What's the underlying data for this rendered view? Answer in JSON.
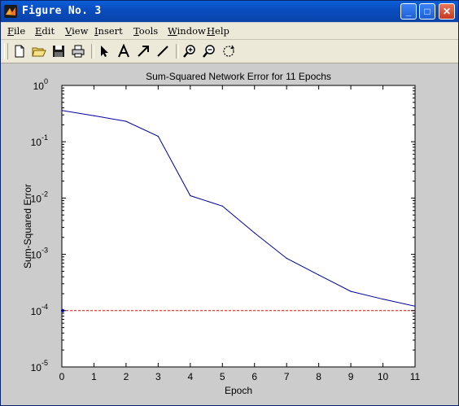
{
  "window": {
    "title": "Figure No. 3",
    "minimize_icon": "minimize-icon",
    "maximize_icon": "maximize-icon",
    "close_icon": "close-icon",
    "app_icon": "matlab-icon"
  },
  "menubar": {
    "items": [
      "File",
      "Edit",
      "View",
      "Insert",
      "Tools",
      "Window",
      "Help"
    ]
  },
  "toolbar": {
    "tools": [
      "new-figure-icon",
      "open-icon",
      "save-icon",
      "print-icon",
      "pointer-icon",
      "text-icon",
      "arrow-icon",
      "line-icon",
      "zoom-in-icon",
      "zoom-out-icon",
      "rotate-icon"
    ]
  },
  "chart_data": {
    "type": "line",
    "title": "Sum-Squared Network Error for 11 Epochs",
    "xlabel": "Epoch",
    "ylabel": "Sum-Squared Error",
    "yscale": "log",
    "xlim": [
      0,
      11
    ],
    "ylim": [
      1e-05,
      1
    ],
    "xticks": [
      "0",
      "1",
      "2",
      "3",
      "4",
      "5",
      "6",
      "7",
      "8",
      "9",
      "10",
      "11"
    ],
    "yticks": [
      {
        "base": "10",
        "exp": "0"
      },
      {
        "base": "10",
        "exp": "-1"
      },
      {
        "base": "10",
        "exp": "-2"
      },
      {
        "base": "10",
        "exp": "-3"
      },
      {
        "base": "10",
        "exp": "-4"
      },
      {
        "base": "10",
        "exp": "-5"
      }
    ],
    "series": [
      {
        "color": "#0000a0",
        "x": [
          0,
          1,
          2,
          3,
          4,
          5,
          6,
          7,
          8,
          9,
          10,
          11
        ],
        "y": [
          0.36,
          0.29,
          0.23,
          0.125,
          0.011,
          0.0072,
          0.0024,
          0.00085,
          0.00043,
          0.00022,
          0.00016,
          0.00012
        ]
      }
    ],
    "goal": {
      "value": 0.0001,
      "color": "#ff0000",
      "style": "dashed"
    },
    "background": "#ffffff",
    "figure_color": "#cccccc"
  }
}
